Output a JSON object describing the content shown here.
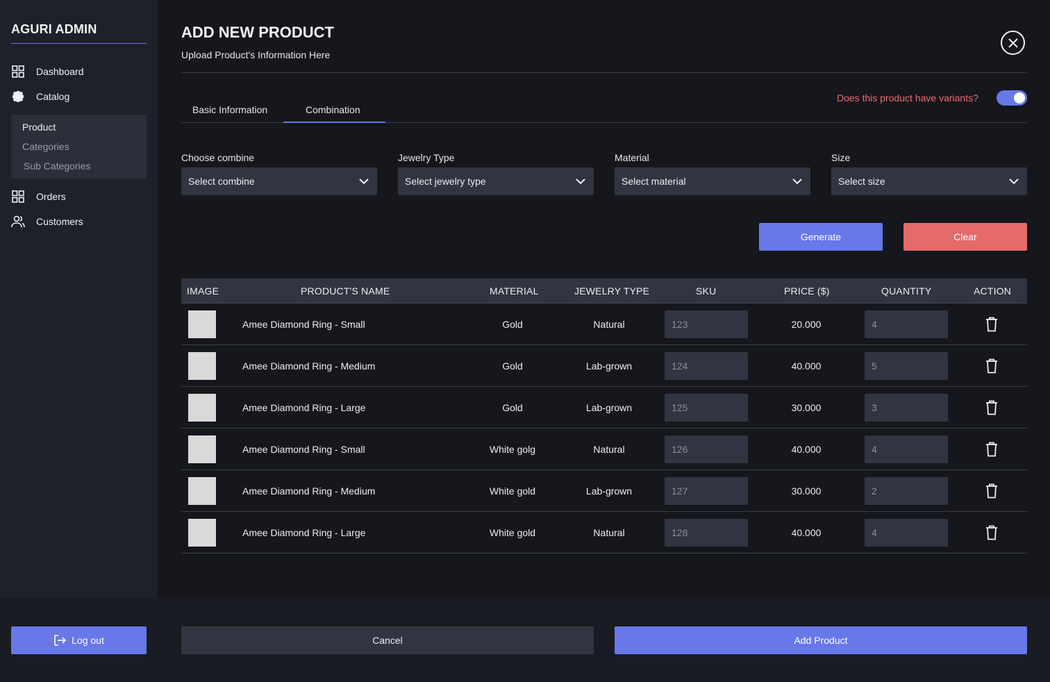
{
  "sidebar": {
    "brand": "AGURI ADMIN",
    "items": [
      {
        "label": "Dashboard",
        "icon": "grid-icon"
      },
      {
        "label": "Catalog",
        "icon": "catalog-icon"
      },
      {
        "label": "Orders",
        "icon": "grid-icon"
      },
      {
        "label": "Customers",
        "icon": "users-icon"
      }
    ],
    "submenu": [
      {
        "label": "Product",
        "active": true
      },
      {
        "label": "Categories",
        "active": false
      },
      {
        "label": "Sub Categories",
        "active": false
      }
    ],
    "logout_label": "Log out"
  },
  "header": {
    "title": "ADD NEW PRODUCT",
    "subtitle": "Upload Product's Information Here"
  },
  "tabs": [
    {
      "label": "Basic Information",
      "active": false
    },
    {
      "label": "Combination",
      "active": true
    }
  ],
  "variants": {
    "question": "Does this product have variants?",
    "enabled": true
  },
  "filters": [
    {
      "label": "Choose combine",
      "placeholder": "Select combine"
    },
    {
      "label": "Jewelry Type",
      "placeholder": "Select jewelry type"
    },
    {
      "label": "Material",
      "placeholder": "Select material"
    },
    {
      "label": "Size",
      "placeholder": "Select size"
    }
  ],
  "actions": {
    "generate": "Generate",
    "clear": "Clear"
  },
  "table": {
    "columns": [
      "IMAGE",
      "PRODUCT'S NAME",
      "MATERIAL",
      "JEWELRY TYPE",
      "SKU",
      "PRICE ($)",
      "QUANTITY",
      "ACTION"
    ],
    "rows": [
      {
        "name": "Amee Diamond Ring - Small",
        "material": "Gold",
        "type": "Natural",
        "sku": "123",
        "price": "20.000",
        "quantity": "4"
      },
      {
        "name": "Amee Diamond Ring - Medium",
        "material": "Gold",
        "type": "Lab-grown",
        "sku": "124",
        "price": "40.000",
        "quantity": "5"
      },
      {
        "name": "Amee Diamond Ring - Large",
        "material": "Gold",
        "type": "Lab-grown",
        "sku": "125",
        "price": "30.000",
        "quantity": "3"
      },
      {
        "name": "Amee Diamond Ring - Small",
        "material": "White golg",
        "type": "Natural",
        "sku": "126",
        "price": "40.000",
        "quantity": "4"
      },
      {
        "name": "Amee Diamond Ring - Medium",
        "material": "White gold",
        "type": "Lab-grown",
        "sku": "127",
        "price": "30.000",
        "quantity": "2"
      },
      {
        "name": "Amee Diamond Ring - Large",
        "material": "White gold",
        "type": "Natural",
        "sku": "128",
        "price": "40.000",
        "quantity": "4"
      }
    ]
  },
  "footer": {
    "cancel": "Cancel",
    "add": "Add Product"
  },
  "colors": {
    "accent": "#6878e8",
    "danger": "#e56a6a",
    "warning_text": "#ef6b6b"
  }
}
